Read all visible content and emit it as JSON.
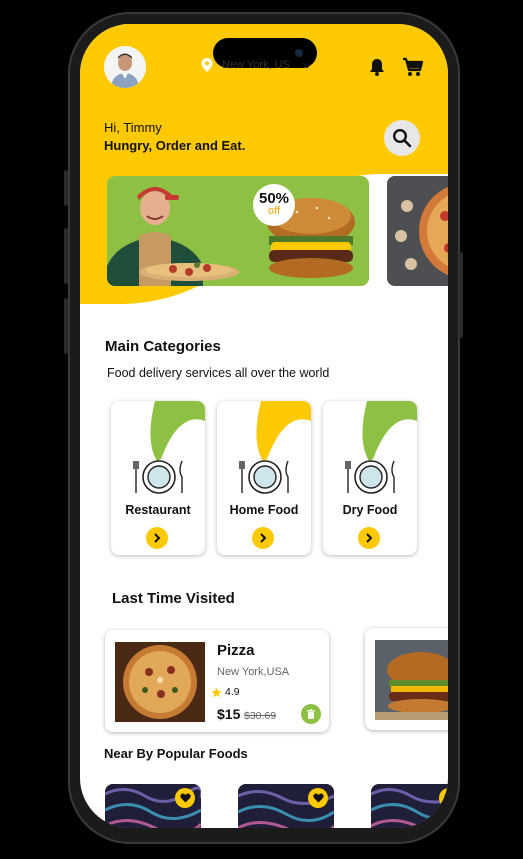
{
  "header": {
    "location": "New York, US",
    "greeting": "Hi, Timmy",
    "tagline": "Hungry, Order and Eat."
  },
  "promo": {
    "percent": "50%",
    "off_label": "off"
  },
  "categories": {
    "title": "Main Categories",
    "subtitle": "Food delivery services all over the world",
    "items": [
      {
        "label": "Restaurant",
        "flag_color": "#8ec044"
      },
      {
        "label": "Home Food",
        "flag_color": "#fdc900"
      },
      {
        "label": "Dry Food",
        "flag_color": "#8ec044"
      }
    ]
  },
  "last_visited": {
    "title": "Last Time Visited",
    "items": [
      {
        "name": "Pizza",
        "location": "New York,USA",
        "rating": "4.9",
        "price": "$15",
        "old_price": "$30.69"
      }
    ]
  },
  "near_by": {
    "title": "Near By Popular Foods"
  },
  "colors": {
    "accent": "#fdc900",
    "green": "#8ec044"
  }
}
